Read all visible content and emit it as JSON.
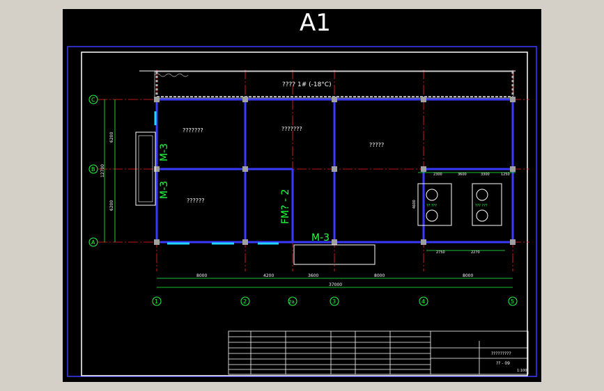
{
  "sheet": {
    "title": "A1"
  },
  "freezer": {
    "label": "???? 1# (-18°C)"
  },
  "rooms": {
    "room1": "???????",
    "room2": "???????",
    "room3": "?????",
    "room4": "??????"
  },
  "doors": {
    "m3_a": "M-3",
    "m3_b": "M-3",
    "m3_c": "M-3",
    "fm2": "FM? - 2"
  },
  "axes": {
    "horizontal": [
      "1",
      "2",
      "2a",
      "3",
      "4",
      "5"
    ],
    "vertical": [
      "C",
      "B",
      "A"
    ]
  },
  "dims": {
    "spans": [
      "8000",
      "4200",
      "3600",
      "8000",
      "8000"
    ],
    "total": "37000",
    "vertical_spans": [
      "6200",
      "6200"
    ],
    "vertical_total": "12700",
    "equip_top": [
      "2300",
      "3600",
      "3300",
      "1250"
    ],
    "equip_bottom": [
      "2750",
      "2270"
    ],
    "equip_side": [
      "4600"
    ]
  },
  "equipment": {
    "unit1": "?? ???",
    "unit2": "??? ???"
  },
  "title_block": {
    "project": "?????????",
    "drawing_no": "?? - 09",
    "scale": "1:100"
  },
  "colors": {
    "background": "#000000",
    "wall": "#3a3aff",
    "axis": "#ff2020",
    "dim": "#20ff40",
    "text": "#ffffff",
    "column": "#a0a0a0"
  }
}
